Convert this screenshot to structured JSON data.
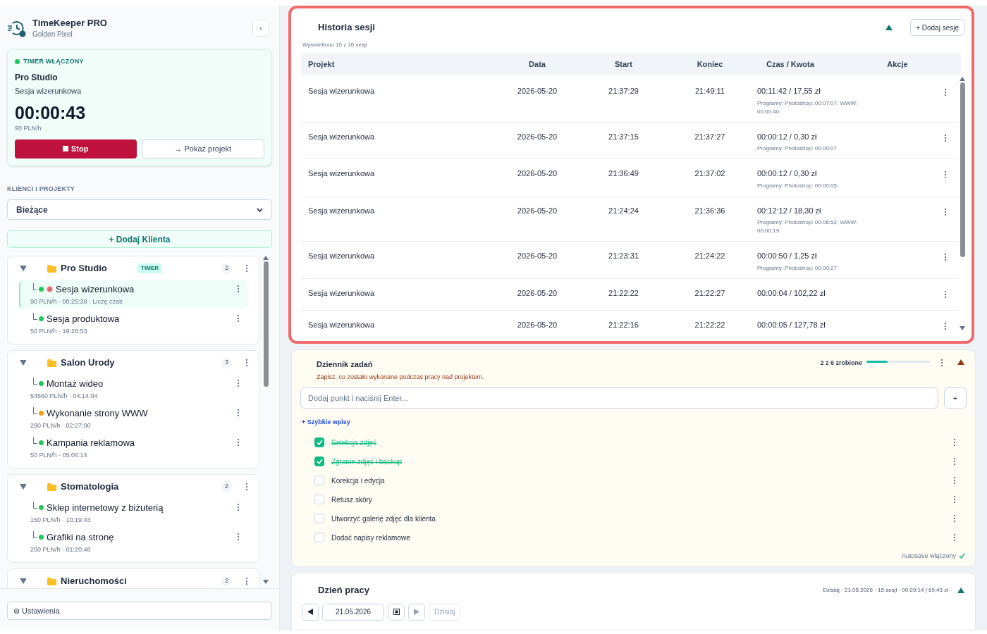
{
  "app": {
    "title": "TimeKeeper PRO",
    "subtitle": "Golden Pixel",
    "collapse": "‹"
  },
  "timer": {
    "running": true,
    "status": "TIMER WŁĄCZONY",
    "client": "Pro Studio",
    "project": "Sesja wizerunkowa",
    "elapsed": "00:00:43",
    "rate": "90 PLN/h",
    "stop": "Stop",
    "show": "→ Pokaż projekt"
  },
  "clients_heading": "KLIENCI I PROJEKTY",
  "filter": "Bieżące",
  "add_client": "+ Dodaj Klienta",
  "clients": [
    {
      "name": "Pro Studio",
      "badge": "TIMER",
      "count": "2",
      "expanded": true,
      "children": [
        {
          "name": "Sesja wizerunkowa",
          "meta": "90 PLN/h · 00:25:38 · Liczę czas",
          "color": "#22c55e",
          "recording": true,
          "selected": true
        },
        {
          "name": "Sesja produktowa",
          "meta": "50 PLN/h · 19:28:53",
          "color": "#22c55e",
          "recording": false,
          "selected": false
        }
      ]
    },
    {
      "name": "Salon Urody",
      "count": "3",
      "expanded": true,
      "children": [
        {
          "name": "Montaż wideo",
          "meta": "54560 PLN/h · 04:14:04",
          "color": "#22c55e",
          "recording": false,
          "selected": false
        },
        {
          "name": "Wykonanie strony WWW",
          "meta": "290 PLN/h · 02:27:00",
          "color": "#f59e0b",
          "recording": false,
          "selected": false
        },
        {
          "name": "Kampania reklamowa",
          "meta": "50 PLN/h · 05:06:14",
          "color": "#22c55e",
          "recording": false,
          "selected": false
        }
      ]
    },
    {
      "name": "Stomatologia",
      "count": "2",
      "expanded": true,
      "children": [
        {
          "name": "Sklep internetowy z biżuterią",
          "meta": "150 PLN/h · 10:19:43",
          "color": "#22c55e",
          "recording": false,
          "selected": false
        },
        {
          "name": "Grafiki na stronę",
          "meta": "200 PLN/h · 01:20:48",
          "color": "#22c55e",
          "recording": false,
          "selected": false
        }
      ]
    },
    {
      "name": "Nieruchomości",
      "count": "2",
      "expanded": true
    }
  ],
  "settings": "Ustawienia",
  "history": {
    "title": "Historia sesji",
    "add": "+ Dodaj sesję",
    "shown": "Wyświetlono 10 z 10 sesji",
    "expanded": true,
    "columns": [
      "Projekt",
      "Data",
      "Start",
      "Koniec",
      "Czas / Kwota",
      "Akcje"
    ],
    "rows": [
      {
        "project": "Sesja wizerunkowa",
        "date": "2026-05-20",
        "start": "21:37:29",
        "end": "21:49:11",
        "amount": "00:11:42 / 17,55 zł",
        "programs": "Programy: Photoshop: 00:07:07, WWW: 00:00:40"
      },
      {
        "project": "Sesja wizerunkowa",
        "date": "2026-05-20",
        "start": "21:37:15",
        "end": "21:37:27",
        "amount": "00:00:12 / 0,30 zł",
        "programs": "Programy: Photoshop: 00:00:07"
      },
      {
        "project": "Sesja wizerunkowa",
        "date": "2026-05-20",
        "start": "21:36:49",
        "end": "21:37:02",
        "amount": "00:00:12 / 0,30 zł",
        "programs": "Programy: Photoshop: 00:00:05"
      },
      {
        "project": "Sesja wizerunkowa",
        "date": "2026-05-20",
        "start": "21:24:24",
        "end": "21:36:36",
        "amount": "00:12:12 / 18,30 zł",
        "programs": "Programy: Photoshop: 00:06:52, WWW: 00:00:19"
      },
      {
        "project": "Sesja wizerunkowa",
        "date": "2026-05-20",
        "start": "21:23:31",
        "end": "21:24:22",
        "amount": "00:00:50 / 1,25 zł",
        "programs": "Programy: Photoshop: 00:00:27"
      },
      {
        "project": "Sesja wizerunkowa",
        "date": "2026-05-20",
        "start": "21:22:22",
        "end": "21:22:27",
        "amount": "00:00:04 / 102,22 zł"
      },
      {
        "project": "Sesja wizerunkowa",
        "date": "2026-05-20",
        "start": "21:22:16",
        "end": "21:22:22",
        "amount": "00:00:05 / 127,78 zł"
      }
    ]
  },
  "tasks": {
    "title": "Dziennik zadań",
    "subtitle": "Zapisz, co zostało wykonane podczas pracy nad projektem.",
    "progress": "2 z 6 zrobione",
    "level": 0.33,
    "expanded": true,
    "placeholder": "Dodaj punkt i naciśnij Enter...",
    "add": "+",
    "quick": "+ Szybkie wpisy",
    "items": [
      {
        "label": "Selekcja zdjęć",
        "checked": true
      },
      {
        "label": "Zgranie zdjęć i backup",
        "checked": true
      },
      {
        "label": "Korekcja i edycja",
        "checked": false
      },
      {
        "label": "Retusz skóry",
        "checked": false
      },
      {
        "label": "Utworzyć galerię zdjęć dla klienta",
        "checked": false
      },
      {
        "label": "Dodać napisy reklamowe",
        "checked": false
      }
    ],
    "autosave": "Autosave włączony"
  },
  "workday": {
    "title": "Dzień pracy",
    "summary": "Dzisiaj · 21.05.2026 · 15 sesji · 00:29:14 | 69,43 zł",
    "date": "21.05.2026",
    "today": "Dzisiaj",
    "today_disabled": true,
    "expanded": true
  }
}
